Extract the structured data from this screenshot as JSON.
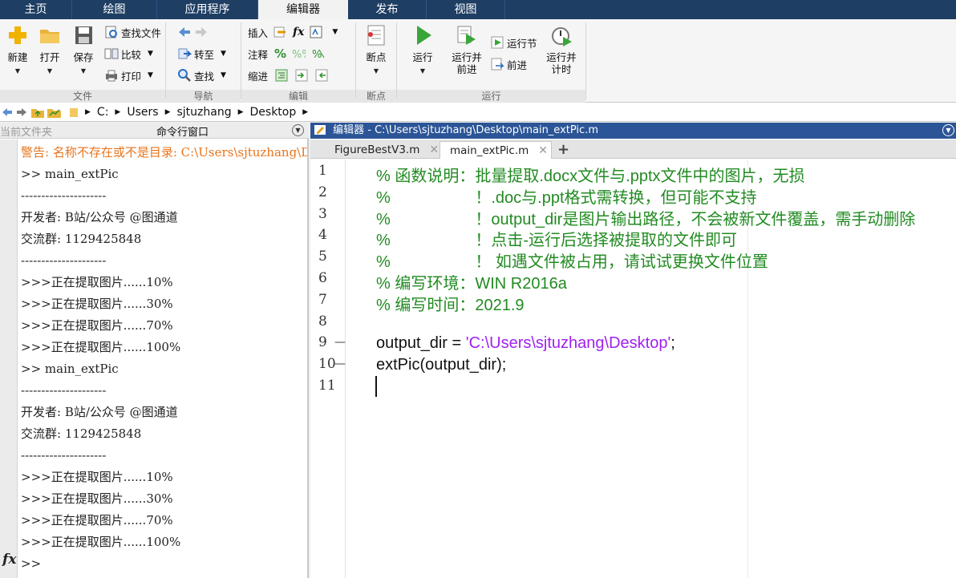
{
  "tabs": [
    "主页",
    "绘图",
    "应用程序",
    "编辑器",
    "发布",
    "视图"
  ],
  "ribbon": {
    "file": {
      "new": "新建",
      "open": "打开",
      "save": "保存",
      "find_files": "查找文件",
      "compare": "比较",
      "print": "打印",
      "group": "文件"
    },
    "nav": {
      "goto": "转至",
      "find": "查找",
      "group": "导航"
    },
    "edit": {
      "insert": "插入",
      "comment": "注释",
      "indent": "缩进",
      "group": "编辑"
    },
    "breakpoints": {
      "label": "断点",
      "group": "断点"
    },
    "run": {
      "run": "运行",
      "run_advance_1": "运行并",
      "run_advance_2": "前进",
      "run_section": "运行节",
      "advance": "前进",
      "run_time_1": "运行并",
      "run_time_2": "计时",
      "group": "运行"
    }
  },
  "address": {
    "drive": "C:",
    "p1": "Users",
    "p2": "sjtuzhang",
    "p3": "Desktop"
  },
  "left_panel": {
    "current_folder_tab": "当前文件夹",
    "command_window_tab": "命令行窗口",
    "lines": [
      {
        "text": "警告: 名称不存在或不是目录: C:\\Users\\sjtuzhang\\Desktop\\main_extPic",
        "type": "warn"
      },
      {
        "text": ">> main_extPic",
        "type": "normal"
      },
      {
        "text": "---------------------",
        "type": "normal"
      },
      {
        "text": "开发者: B站/公众号 @图通道",
        "type": "normal"
      },
      {
        "text": "交流群: 1129425848",
        "type": "normal"
      },
      {
        "text": "---------------------",
        "type": "normal"
      },
      {
        "text": ">>>正在提取图片......10%",
        "type": "normal"
      },
      {
        "text": ">>>正在提取图片......30%",
        "type": "normal"
      },
      {
        "text": ">>>正在提取图片......70%",
        "type": "normal"
      },
      {
        "text": ">>>正在提取图片......100%",
        "type": "normal"
      },
      {
        "text": ">> main_extPic",
        "type": "normal"
      },
      {
        "text": "---------------------",
        "type": "normal"
      },
      {
        "text": "开发者: B站/公众号 @图通道",
        "type": "normal"
      },
      {
        "text": "交流群: 1129425848",
        "type": "normal"
      },
      {
        "text": "---------------------",
        "type": "normal"
      },
      {
        "text": ">>>正在提取图片......10%",
        "type": "normal"
      },
      {
        "text": ">>>正在提取图片......30%",
        "type": "normal"
      },
      {
        "text": ">>>正在提取图片......70%",
        "type": "normal"
      },
      {
        "text": ">>>正在提取图片......100%",
        "type": "normal"
      }
    ],
    "prompt": ">>",
    "fx": "fx"
  },
  "editor": {
    "title": "编辑器 - C:\\Users\\sjtuzhang\\Desktop\\main_extPic.m",
    "tabs": [
      {
        "label": "FigureBestV3.m",
        "active": false
      },
      {
        "label": "main_extPic.m",
        "active": true
      }
    ],
    "line_numbers": [
      "1",
      "2",
      "3",
      "4",
      "5",
      "6",
      "7",
      "8",
      "9",
      "10",
      "11"
    ],
    "code": [
      {
        "text": "% 函数说明：批量提取.docx文件与.pptx文件中的图片，无损",
        "type": "comment"
      },
      {
        "text": "%                   ！.doc与.ppt格式需转换，但可能不支持",
        "type": "comment"
      },
      {
        "text": "%                   ！output_dir是图片输出路径，不会被新文件覆盖，需手动删除",
        "type": "comment"
      },
      {
        "text": "%                   ！点击-运行后选择被提取的文件即可",
        "type": "comment"
      },
      {
        "text": "%                   ！ 如遇文件被占用，请试试更换文件位置",
        "type": "comment"
      },
      {
        "text": "% 编写环境：WIN R2016a",
        "type": "comment"
      },
      {
        "text": "% 编写时间：2021.9",
        "type": "comment"
      },
      {
        "text": "",
        "type": "plain"
      },
      {
        "prefix": "output_dir = ",
        "string": "'C:\\Users\\sjtuzhang\\Desktop'",
        "suffix": ";",
        "type": "assign"
      },
      {
        "text": "extPic(output_dir);",
        "type": "plain"
      },
      {
        "text": "",
        "type": "plain"
      }
    ]
  },
  "colors": {
    "tab_bar": "#1e3e63",
    "editor_title": "#2b5597",
    "comment": "#228b22",
    "string": "#a020f0",
    "warning": "#e8741c"
  }
}
